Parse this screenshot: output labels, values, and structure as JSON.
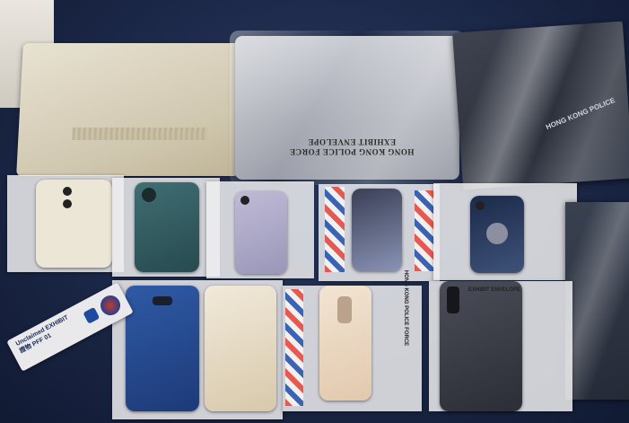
{
  "scene": {
    "description_visible_text": {
      "silver_laptop_label_line1": "HONG KONG POLICE FORCE",
      "silver_laptop_label_line2": "EXHIBIT ENVELOPE",
      "bag_strip_label": "HONG KONG POLICE FORCE",
      "bag_strip_label_2": "EXHIBIT ENVELOPE",
      "exhibit_tag_line1": "Unclaimed EXHIBIT",
      "exhibit_tag_line2": "證物 PFF 01",
      "dark_laptop_text": "HONG KONG POLICE"
    }
  },
  "colors": {
    "table": "#1a2645",
    "tape_red": "#e94b43",
    "tape_blue": "#2b56b0"
  }
}
